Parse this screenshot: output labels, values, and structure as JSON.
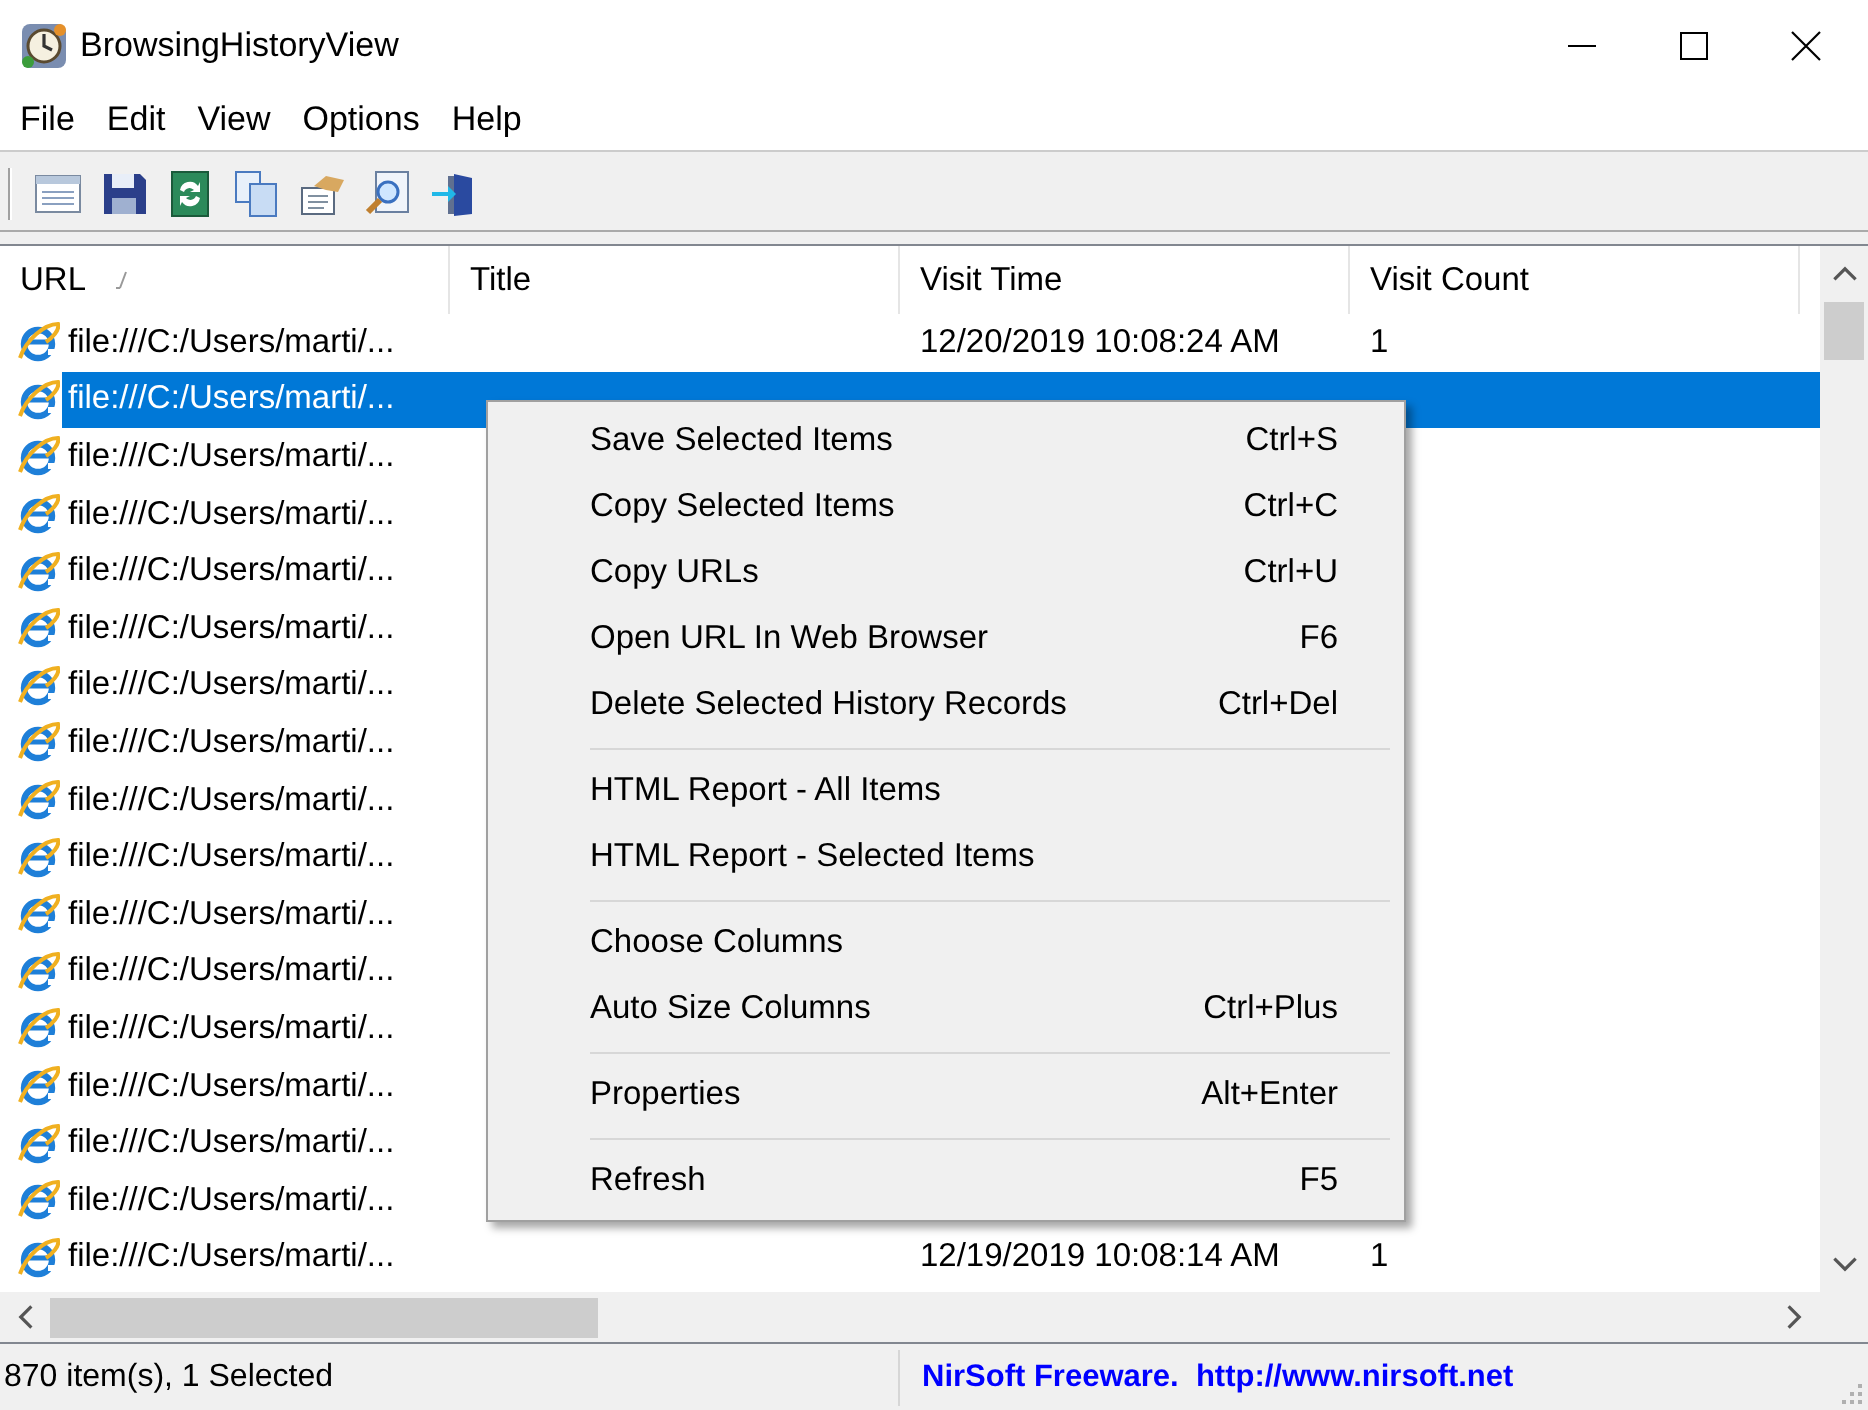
{
  "window": {
    "title": "BrowsingHistoryView"
  },
  "menu_bar": [
    "File",
    "Edit",
    "View",
    "Options",
    "Help"
  ],
  "table": {
    "columns": [
      {
        "label": "URL",
        "sorted": true
      },
      {
        "label": "Title",
        "sorted": false
      },
      {
        "label": "Visit Time",
        "sorted": false
      },
      {
        "label": "Visit Count",
        "sorted": false
      }
    ],
    "rows": [
      {
        "url": "file:///C:/Users/marti/...",
        "visit_time": "12/20/2019 10:08:24 AM",
        "visit_count": "1",
        "selected": false
      },
      {
        "url": "file:///C:/Users/marti/...",
        "selected": true
      },
      {
        "url": "file:///C:/Users/marti/...",
        "selected": false
      },
      {
        "url": "file:///C:/Users/marti/...",
        "selected": false
      },
      {
        "url": "file:///C:/Users/marti/...",
        "selected": false
      },
      {
        "url": "file:///C:/Users/marti/...",
        "selected": false
      },
      {
        "url": "file:///C:/Users/marti/...",
        "selected": false
      },
      {
        "url": "file:///C:/Users/marti/...",
        "selected": false
      },
      {
        "url": "file:///C:/Users/marti/...",
        "selected": false
      },
      {
        "url": "file:///C:/Users/marti/...",
        "selected": false
      },
      {
        "url": "file:///C:/Users/marti/...",
        "selected": false
      },
      {
        "url": "file:///C:/Users/marti/...",
        "selected": false
      },
      {
        "url": "file:///C:/Users/marti/...",
        "selected": false
      },
      {
        "url": "file:///C:/Users/marti/...",
        "selected": false
      },
      {
        "url": "file:///C:/Users/marti/...",
        "selected": false
      },
      {
        "url": "file:///C:/Users/marti/...",
        "selected": false
      },
      {
        "url": "file:///C:/Users/marti/...",
        "visit_time": "12/19/2019 10:08:14 AM",
        "visit_count": "1",
        "selected": false
      }
    ]
  },
  "context_menu": [
    {
      "kind": "item",
      "label": "Save Selected Items",
      "shortcut": "Ctrl+S"
    },
    {
      "kind": "item",
      "label": "Copy Selected Items",
      "shortcut": "Ctrl+C"
    },
    {
      "kind": "item",
      "label": "Copy URLs",
      "shortcut": "Ctrl+U"
    },
    {
      "kind": "item",
      "label": "Open URL In Web Browser",
      "shortcut": "F6"
    },
    {
      "kind": "item",
      "label": "Delete Selected History Records",
      "shortcut": "Ctrl+Del"
    },
    {
      "kind": "separator"
    },
    {
      "kind": "item",
      "label": "HTML Report - All Items"
    },
    {
      "kind": "item",
      "label": "HTML Report - Selected Items"
    },
    {
      "kind": "separator"
    },
    {
      "kind": "item",
      "label": "Choose Columns"
    },
    {
      "kind": "item",
      "label": "Auto Size Columns",
      "shortcut": "Ctrl+Plus"
    },
    {
      "kind": "separator"
    },
    {
      "kind": "item",
      "label": "Properties",
      "shortcut": "Alt+Enter"
    },
    {
      "kind": "separator"
    },
    {
      "kind": "item",
      "label": "Refresh",
      "shortcut": "F5"
    }
  ],
  "status_bar": {
    "count": "870 item(s), 1 Selected",
    "credit": "NirSoft Freeware.  http://www.nirsoft.net"
  }
}
